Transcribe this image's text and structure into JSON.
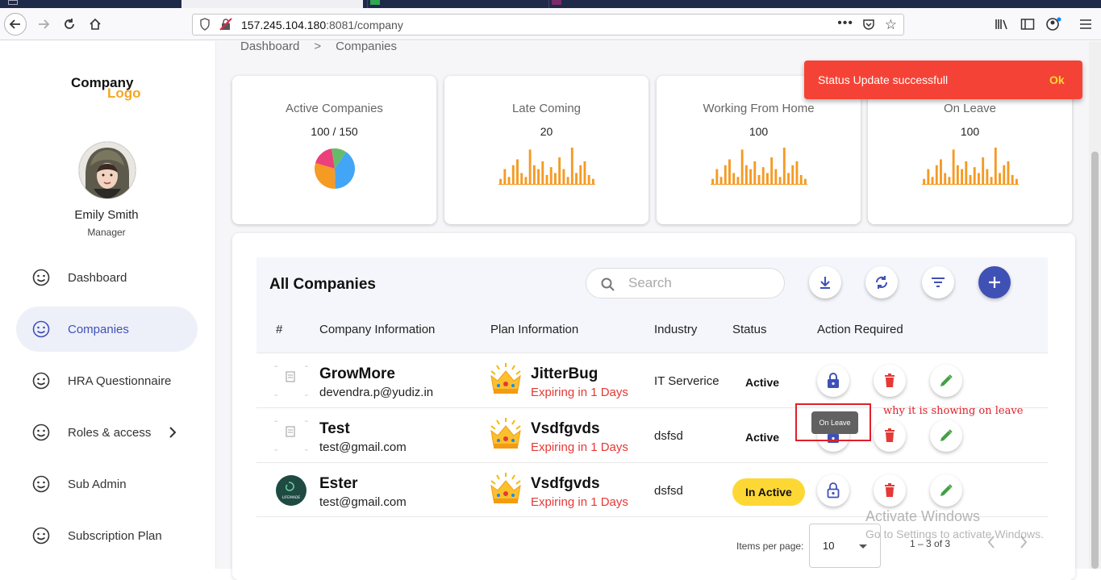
{
  "browser": {
    "url_host": "157.245.104.180",
    "url_rest": ":8081/company"
  },
  "sidebar": {
    "logo_line1": "Company",
    "logo_line2": "Logo",
    "user_name": "Emily Smith",
    "user_role": "Manager",
    "items": [
      {
        "label": "Dashboard"
      },
      {
        "label": "Companies"
      },
      {
        "label": "HRA Questionnaire"
      },
      {
        "label": "Roles & access"
      },
      {
        "label": "Sub Admin"
      },
      {
        "label": "Subscription Plan"
      }
    ]
  },
  "breadcrumb": {
    "root": "Dashboard",
    "separator": ">",
    "current": "Companies"
  },
  "cards": [
    {
      "title": "Active Companies",
      "value": "100 / 150"
    },
    {
      "title": "Late Coming",
      "value": "20"
    },
    {
      "title": "Working From Home",
      "value": "100"
    },
    {
      "title": "On Leave",
      "value": "100"
    }
  ],
  "chart_data": [
    {
      "type": "pie",
      "title": "",
      "values": [
        40,
        30,
        18,
        12
      ],
      "colors": [
        "#42a5f5",
        "#f59a23",
        "#ec407a",
        "#66bb6a"
      ]
    },
    {
      "type": "bar",
      "title": "",
      "values": [
        3,
        8,
        4,
        10,
        13,
        6,
        4,
        18,
        10,
        8,
        12,
        5,
        9,
        6,
        14,
        8,
        4,
        19,
        6,
        10,
        12,
        5,
        3
      ],
      "color": "#f59a23"
    },
    {
      "type": "bar",
      "title": "",
      "values": [
        3,
        8,
        4,
        10,
        13,
        6,
        4,
        18,
        10,
        8,
        12,
        5,
        9,
        6,
        14,
        8,
        4,
        19,
        6,
        10,
        12,
        5,
        3
      ],
      "color": "#f59a23"
    },
    {
      "type": "bar",
      "title": "",
      "values": [
        3,
        8,
        4,
        10,
        13,
        6,
        4,
        18,
        10,
        8,
        12,
        5,
        9,
        6,
        14,
        8,
        4,
        19,
        6,
        10,
        12,
        5,
        3
      ],
      "color": "#f59a23"
    }
  ],
  "table": {
    "title": "All Companies",
    "search_placeholder": "Search",
    "headers": [
      "#",
      "Company Information",
      "Plan Information",
      "Industry",
      "Status",
      "Action Required"
    ],
    "rows": [
      {
        "name": "GrowMore",
        "email": "devendra.p@yudiz.in",
        "plan": "JitterBug",
        "expiry": "Expiring in 1 Days",
        "industry": "IT Serverice",
        "status": "Active"
      },
      {
        "name": "Test",
        "email": "test@gmail.com",
        "plan": "Vsdfgvds",
        "expiry": "Expiring in 1 Days",
        "industry": "dsfsd",
        "status": "Active"
      },
      {
        "name": "Ester",
        "email": "test@gmail.com",
        "plan": "Vsdfgvds",
        "expiry": "Expiring in 1 Days",
        "industry": "dsfsd",
        "status": "In Active"
      }
    ],
    "row3_logo_text": "LIFEMADE"
  },
  "tooltip": "On Leave",
  "annotation": "why it is showing on leave",
  "pagination": {
    "label": "Items per page:",
    "size": "10",
    "range": "1 – 3 of 3"
  },
  "toast": {
    "message": "Status Update successfull",
    "action": "Ok"
  },
  "watermark": {
    "line1": "Activate Windows",
    "line2": "Go to Settings to activate Windows."
  },
  "colors": {
    "primary": "#3f51b5",
    "accent": "#f59a23",
    "danger": "#e53935",
    "success": "#43a047",
    "toast": "#f44336"
  }
}
